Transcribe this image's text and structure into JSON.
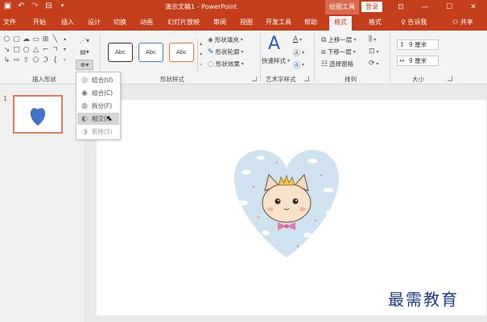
{
  "titlebar": {
    "document_title": "演示文稿1 - PowerPoint",
    "context_tools": "绘图工具",
    "login": "登录",
    "window_controls": {
      "ribbon_display": "⊡",
      "minimize": "—",
      "maximize": "☐",
      "close": "✕"
    }
  },
  "tabs": {
    "file": "文件",
    "home": "开始",
    "insert": "插入",
    "design": "设计",
    "transitions": "切换",
    "animations": "动画",
    "slideshow": "幻灯片放映",
    "review": "审阅",
    "view": "视图",
    "developer": "开发工具",
    "help": "帮助",
    "format_ctx": "格式",
    "format": "格式",
    "tell_me": "告诉我",
    "share": "共享"
  },
  "ribbon": {
    "groups": {
      "insert_shapes": "插入形状",
      "shape_styles": "形状样式",
      "wordart_styles": "艺术字样式",
      "arrange": "排列",
      "size": "大小"
    },
    "style_swatches": [
      "Abc",
      "Abc",
      "Abc"
    ],
    "style_swatch_colors": [
      "#333333",
      "#4a7ebb",
      "#e07b39"
    ],
    "shape_fill": "形状填充",
    "shape_outline": "形状轮廓",
    "shape_effects": "形状效果",
    "quick_styles": "快速样式",
    "bring_forward": "上移一层",
    "send_backward": "下移一层",
    "selection_pane": "选择窗格",
    "height_value": "9 厘米",
    "width_value": "9 厘米"
  },
  "merge_menu": {
    "items": [
      {
        "label": "结合(U)",
        "icon": "union-icon",
        "state": "normal"
      },
      {
        "label": "组合(C)",
        "icon": "combine-icon",
        "state": "normal"
      },
      {
        "label": "拆分(F)",
        "icon": "fragment-icon",
        "state": "normal"
      },
      {
        "label": "相交(I)",
        "icon": "intersect-icon",
        "state": "hover"
      },
      {
        "label": "剪除(S)",
        "icon": "subtract-icon",
        "state": "disabled"
      }
    ]
  },
  "thumbnails": {
    "slide_number": "1"
  },
  "colors": {
    "accent": "#c43e1c",
    "heart_thumb": "#3f73c6",
    "heart_bg": "#cfe2ef",
    "thumb_border": "#e2795a"
  },
  "watermark": "最需教育"
}
